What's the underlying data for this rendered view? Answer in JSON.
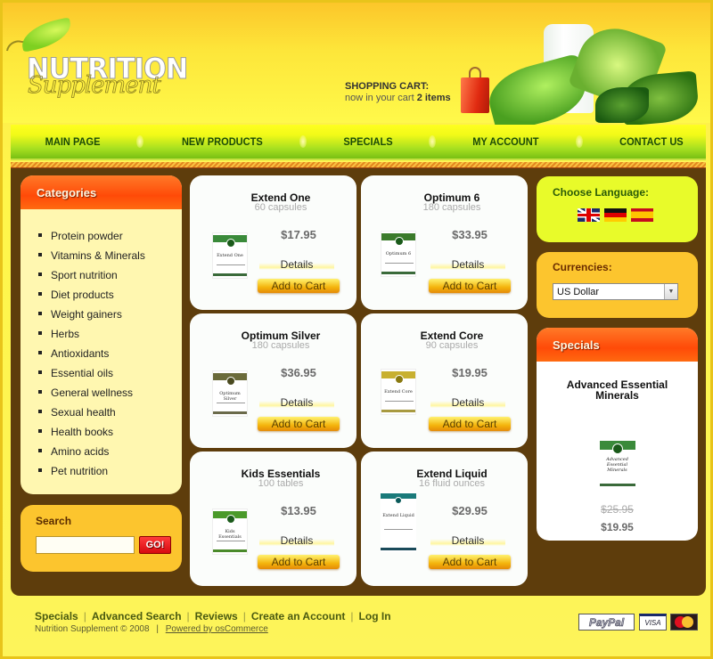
{
  "header": {
    "logo_title": "NUTRITION",
    "logo_subtitle": "Supplement",
    "cart_label": "SHOPPING CART:",
    "cart_status_prefix": "now in your cart ",
    "cart_count": "2 items"
  },
  "nav": {
    "items": [
      {
        "label": "MAIN PAGE"
      },
      {
        "label": "NEW PRODUCTS"
      },
      {
        "label": "SPECIALS"
      },
      {
        "label": "MY ACCOUNT"
      },
      {
        "label": "CONTACT US"
      }
    ]
  },
  "categories": {
    "title": "Categories",
    "items": [
      "Protein powder",
      "Vitamins & Minerals",
      "Sport nutrition",
      "Diet products",
      "Weight gainers",
      "Herbs",
      "Antioxidants",
      "Essential oils",
      "General wellness",
      "Sexual health",
      "Health books",
      "Amino acids",
      "Pet nutrition"
    ]
  },
  "search": {
    "title": "Search",
    "value": "",
    "button": "GO!"
  },
  "products": [
    {
      "name": "Extend One",
      "subtitle": "60 capsules",
      "price": "$17.95",
      "image_label": "Extend One",
      "details": "Details",
      "add_to_cart": "Add to Cart",
      "band_color": "#3a8a3a"
    },
    {
      "name": "Optimum 6",
      "subtitle": "180 capsules",
      "price": "$33.95",
      "image_label": "Optimum 6",
      "details": "Details",
      "add_to_cart": "Add to Cart",
      "band_color": "#3a7a2a"
    },
    {
      "name": "Optimum Silver",
      "subtitle": "180 capsules",
      "price": "$36.95",
      "image_label": "Optimum Silver",
      "details": "Details",
      "add_to_cart": "Add to Cart",
      "band_color": "#6a6a3a"
    },
    {
      "name": "Extend Core",
      "subtitle": "90 capsules",
      "price": "$19.95",
      "image_label": "Extend Core",
      "details": "Details",
      "add_to_cart": "Add to Cart",
      "band_color": "#c8b030"
    },
    {
      "name": "Kids Essentials",
      "subtitle": "100 tables",
      "price": "$13.95",
      "image_label": "Kids Essentials",
      "details": "Details",
      "add_to_cart": "Add to Cart",
      "band_color": "#4a9a2a"
    },
    {
      "name": "Extend Liquid",
      "subtitle": "16 fluid ounces",
      "price": "$29.95",
      "image_label": "Extend Liquid",
      "details": "Details",
      "add_to_cart": "Add to Cart",
      "band_color": "#1a7a7a"
    }
  ],
  "language": {
    "title": "Choose Language:",
    "flags": [
      "english-flag",
      "german-flag",
      "spanish-flag"
    ]
  },
  "currencies": {
    "title": "Currencies:",
    "selected": "US Dollar"
  },
  "specials": {
    "title": "Specials",
    "product_name": "Advanced Essential Minerals",
    "image_label": "Advanced Essential Minerals",
    "old_price": "$25.95",
    "new_price": "$19.95"
  },
  "footer": {
    "links": [
      "Specials",
      "Advanced Search",
      "Reviews",
      "Create an Account",
      "Log In"
    ],
    "separator": "|",
    "copyright": "Nutrition Supplement © 2008",
    "powered": "Powered by osCommerce",
    "payments": [
      "PayPal",
      "VISA",
      "MasterCard"
    ]
  },
  "colors": {
    "page_yellow": "#fff64a",
    "main_brown": "#5e3d0c",
    "header_orange": "#ff4a08",
    "nav_green": "#78c014",
    "language_lime": "#e8fb2a",
    "box_orange": "#fcc52e",
    "category_cream": "#fff7b0"
  }
}
